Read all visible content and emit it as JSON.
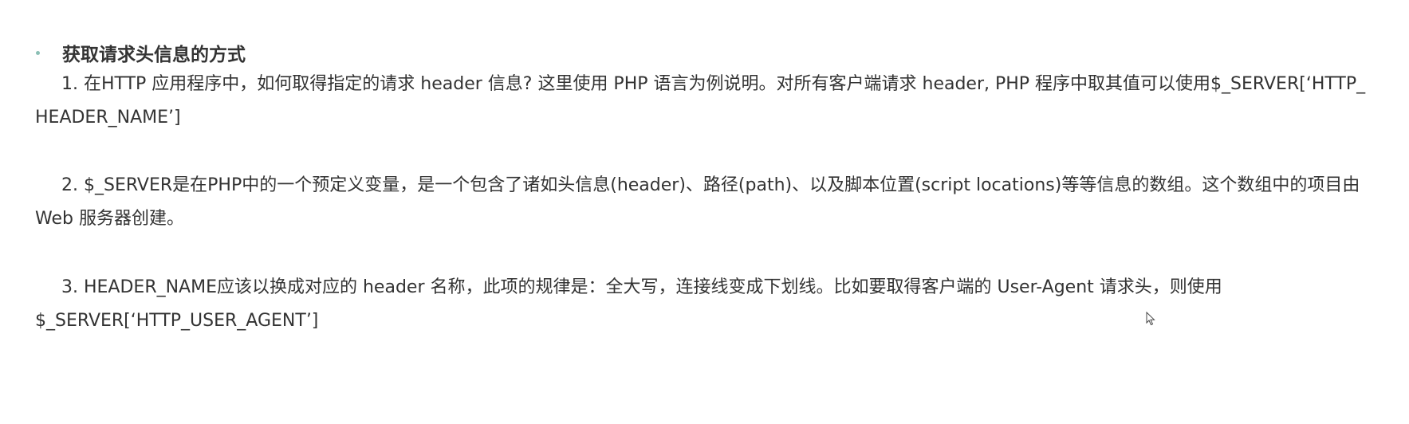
{
  "section": {
    "heading": "获取请求头信息的方式",
    "paragraphs": [
      "1. 在HTTP 应用程序中，如何取得指定的请求 header 信息? 这里使用 PHP 语言为例说明。对所有客户端请求 header, PHP 程序中取其值可以使用$_SERVER[‘HTTP_ HEADER_NAME’]",
      "2. $_SERVER是在PHP中的一个预定义变量，是一个包含了诸如头信息(header)、路径(path)、以及脚本位置(script locations)等等信息的数组。这个数组中的项目由 Web 服务器创建。",
      "3. HEADER_NAME应该以换成对应的 header 名称，此项的规律是：全大写，连接线变成下划线。比如要取得客户端的 User-Agent 请求头，则使用 $_SERVER[‘HTTP_USER_AGENT’]"
    ]
  },
  "icons": {
    "bullet": "bullet-dot-icon",
    "cursor": "mouse-pointer-icon"
  },
  "colors": {
    "text": "#333333",
    "bullet": "#8bbfb5",
    "background": "#ffffff"
  }
}
